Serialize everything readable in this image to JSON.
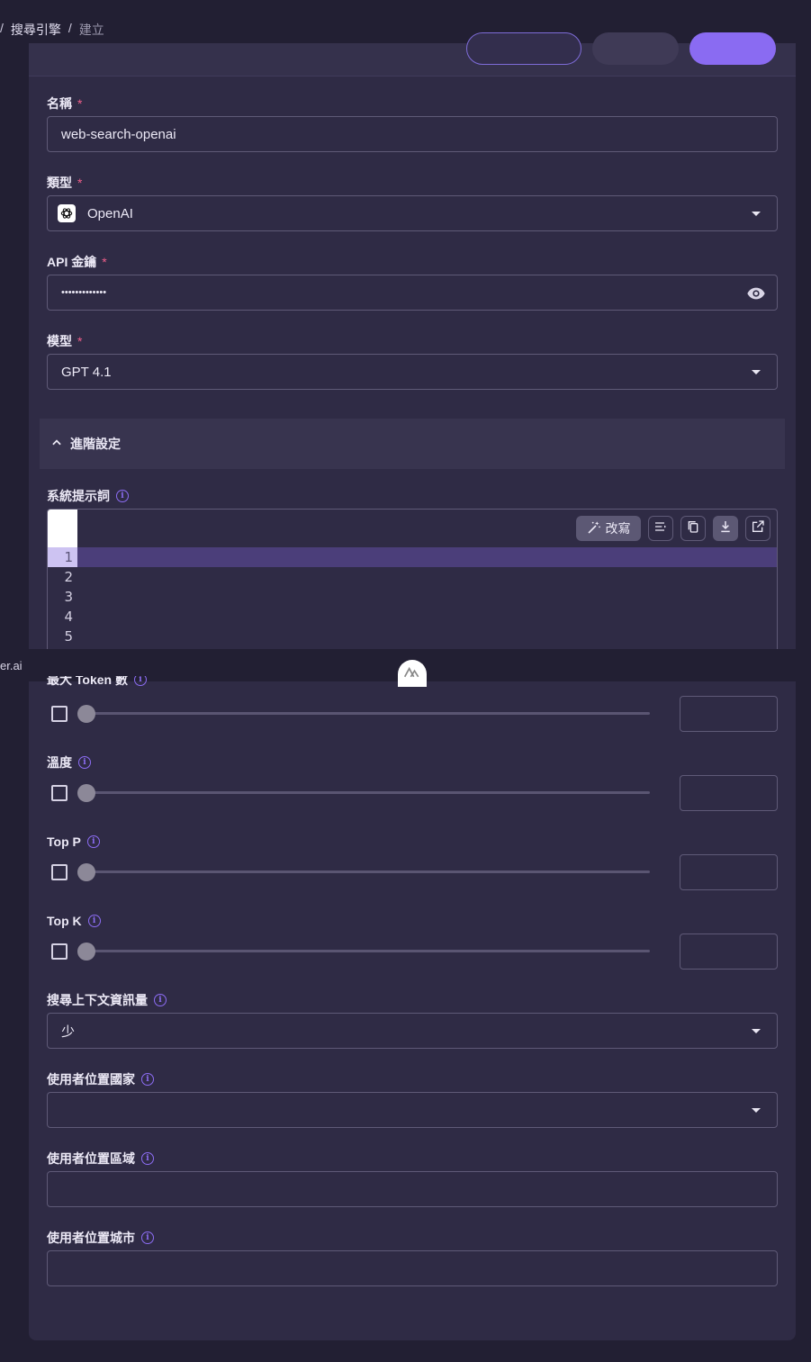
{
  "breadcrumb": {
    "items": [
      "搜尋引擎"
    ],
    "current": "建立",
    "separator": "/"
  },
  "form": {
    "name": {
      "label": "名稱",
      "required_mark": "*",
      "value": "web-search-openai"
    },
    "type": {
      "label": "類型",
      "required_mark": "*",
      "value": "OpenAI",
      "icon": "openai-logo-icon"
    },
    "api_key": {
      "label": "API 金鑰",
      "required_mark": "*",
      "value": "•••••••••••••",
      "icon": "eye-icon"
    },
    "model": {
      "label": "模型",
      "required_mark": "*",
      "value": "GPT 4.1"
    },
    "advanced": {
      "label": "進階設定",
      "expanded": true
    },
    "system_prompt": {
      "label": "系統提示詞",
      "rewrite_label": "改寫",
      "line_numbers": [
        "1",
        "2",
        "3",
        "4",
        "5"
      ],
      "active_line": "1",
      "toolbar_icons": [
        "magic-wand-icon",
        "format-lines-icon",
        "copy-icon",
        "download-icon",
        "open-external-icon"
      ]
    },
    "max_tokens": {
      "label": "最大 Token 數",
      "checked": false,
      "slider": 0
    },
    "temperature": {
      "label": "溫度",
      "checked": false,
      "slider": 0
    },
    "top_p": {
      "label": "Top P",
      "checked": false,
      "slider": 0
    },
    "top_k": {
      "label": "Top K",
      "checked": false,
      "slider": 0
    },
    "search_context": {
      "label": "搜尋上下文資訊量",
      "value": "少"
    },
    "user_country": {
      "label": "使用者位置國家",
      "value": ""
    },
    "user_region": {
      "label": "使用者位置區域",
      "value": ""
    },
    "user_city": {
      "label": "使用者位置城市",
      "value": ""
    }
  },
  "footer": {
    "site_text": "er.ai",
    "logo": "nuxt-logo-icon"
  },
  "colors": {
    "background": "#221f33",
    "card": "#2f2b45",
    "accent": "#8a6bf2",
    "required": "#ef5f8a",
    "border": "#5f5a77"
  }
}
